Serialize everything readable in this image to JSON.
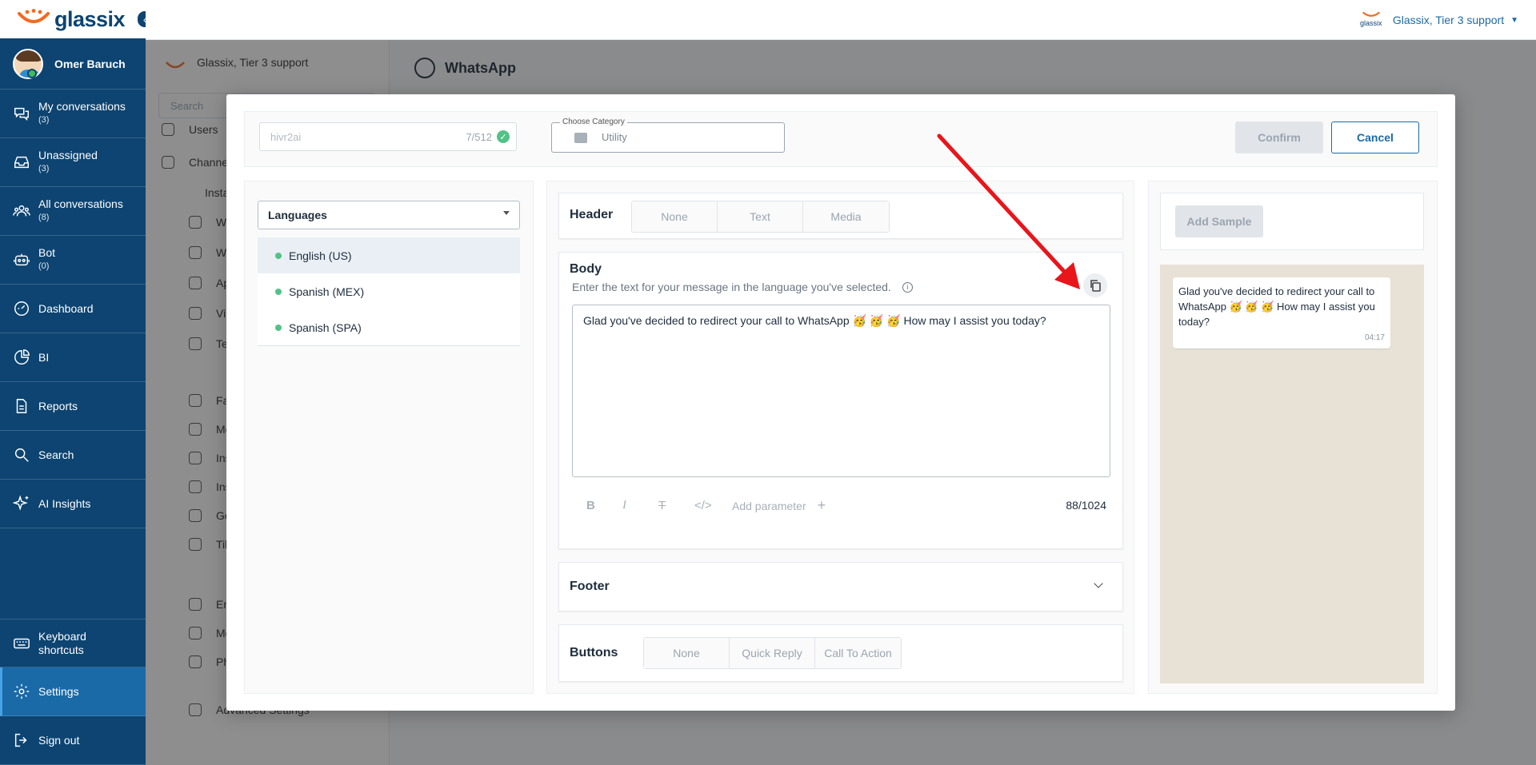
{
  "brand": {
    "name": "glassix"
  },
  "user": {
    "name": "Omer Baruch"
  },
  "nav": {
    "items": [
      {
        "label": "My conversations",
        "count": "(3)",
        "icon": "chat-bubbles-icon"
      },
      {
        "label": "Unassigned",
        "count": "(3)",
        "icon": "inbox-icon"
      },
      {
        "label": "All conversations",
        "count": "(8)",
        "icon": "users-icon"
      },
      {
        "label": "Bot",
        "count": "(0)",
        "icon": "robot-icon"
      },
      {
        "label": "Dashboard",
        "count": "",
        "icon": "dashboard-icon"
      },
      {
        "label": "BI",
        "count": "",
        "icon": "pie-chart-icon"
      },
      {
        "label": "Reports",
        "count": "",
        "icon": "document-icon"
      },
      {
        "label": "Search",
        "count": "",
        "icon": "search-icon"
      },
      {
        "label": "AI Insights",
        "count": "",
        "icon": "sparkle-icon"
      }
    ],
    "bottom": {
      "shortcuts": "Keyboard shortcuts",
      "settings": "Settings",
      "signout": "Sign out"
    }
  },
  "topbar": {
    "account": "Glassix, Tier 3 support",
    "logo_small": "glassix"
  },
  "settings_bg": {
    "org": "Glassix, Tier 3 support",
    "search_placeholder": "Search",
    "title": "WhatsApp",
    "items": [
      "Users",
      "Channe",
      "Insta",
      "Wh",
      "We",
      "Ap",
      "Vib",
      "Tex",
      "Fa",
      "Me",
      "Ins",
      "Ins",
      "Go",
      "Tik",
      "Em",
      "Mo",
      "Ph",
      "Advanced Settings"
    ]
  },
  "modal": {
    "template_name": "hivr2ai",
    "name_count": "7/512",
    "category_legend": "Choose Category",
    "category_value": "Utility",
    "confirm": "Confirm",
    "cancel": "Cancel",
    "languages_label": "Languages",
    "languages": [
      "English (US)",
      "Spanish (MEX)",
      "Spanish (SPA)"
    ],
    "header": {
      "title": "Header",
      "options": [
        "None",
        "Text",
        "Media"
      ]
    },
    "body": {
      "title": "Body",
      "help": "Enter the text for your message in the language you've selected.",
      "text": "Glad you've decided to redirect your call to WhatsApp 🥳 🥳 🥳  How may I assist you today?",
      "add_parameter": "Add parameter",
      "char_count": "88/1024"
    },
    "footer": {
      "title": "Footer"
    },
    "buttons": {
      "title": "Buttons",
      "options": [
        "None",
        "Quick Reply",
        "Call To Action"
      ]
    },
    "preview": {
      "add_sample": "Add Sample",
      "message": "Glad you've decided to redirect your call to WhatsApp 🥳 🥳 🥳  How may I assist you today?",
      "time": "04:17"
    }
  },
  "colors": {
    "nav": "#0d4471",
    "accent": "#1a6aa8",
    "arrow": "#e8151b",
    "online": "#43b85c"
  }
}
